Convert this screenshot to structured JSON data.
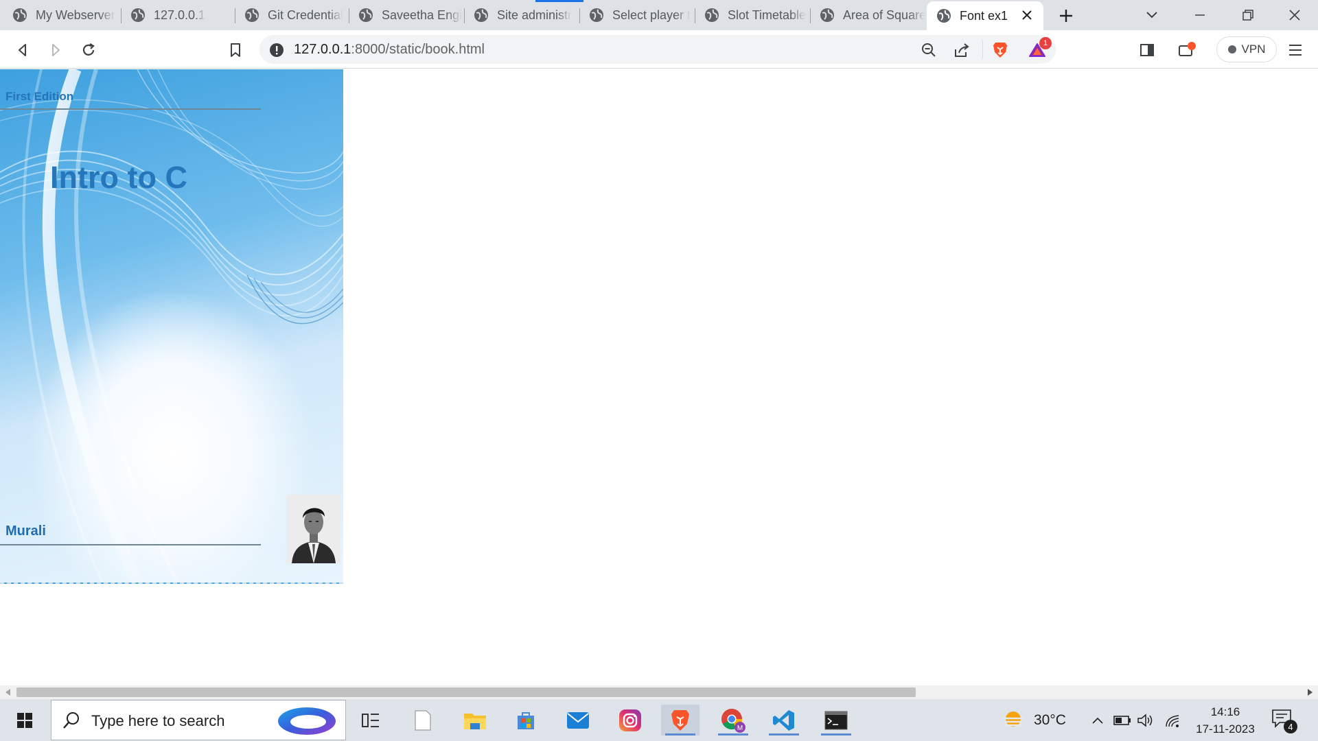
{
  "browser": {
    "tabs": [
      {
        "label": "My Webserver"
      },
      {
        "label": "127.0.0.1"
      },
      {
        "label": "Git Credential"
      },
      {
        "label": "Saveetha Engi"
      },
      {
        "label": "Site administr"
      },
      {
        "label": "Select player t"
      },
      {
        "label": "Slot Timetable"
      },
      {
        "label": "Area of Square"
      },
      {
        "label": "Font ex1",
        "active": true
      }
    ],
    "url_host": "127.0.0.1",
    "url_path": ":8000/static/book.html",
    "vpn_label": "VPN",
    "alert_count": "1",
    "accent": "#1a73e8"
  },
  "page": {
    "edition": "First Edition",
    "title": "Intro to C",
    "author": "Murali",
    "colors": {
      "title": "#2676bb",
      "cover_blue": "#3da0de"
    }
  },
  "taskbar": {
    "search_placeholder": "Type here to search",
    "apps": [
      "task-view-icon",
      "notepad-icon",
      "file-explorer-icon",
      "microsoft-store-icon",
      "mail-icon",
      "instagram-icon",
      "brave-icon",
      "chrome-icon",
      "vscode-icon",
      "terminal-icon"
    ],
    "weather": "30°C",
    "time": "14:16",
    "date": "17-11-2023",
    "notification_count": "4"
  }
}
